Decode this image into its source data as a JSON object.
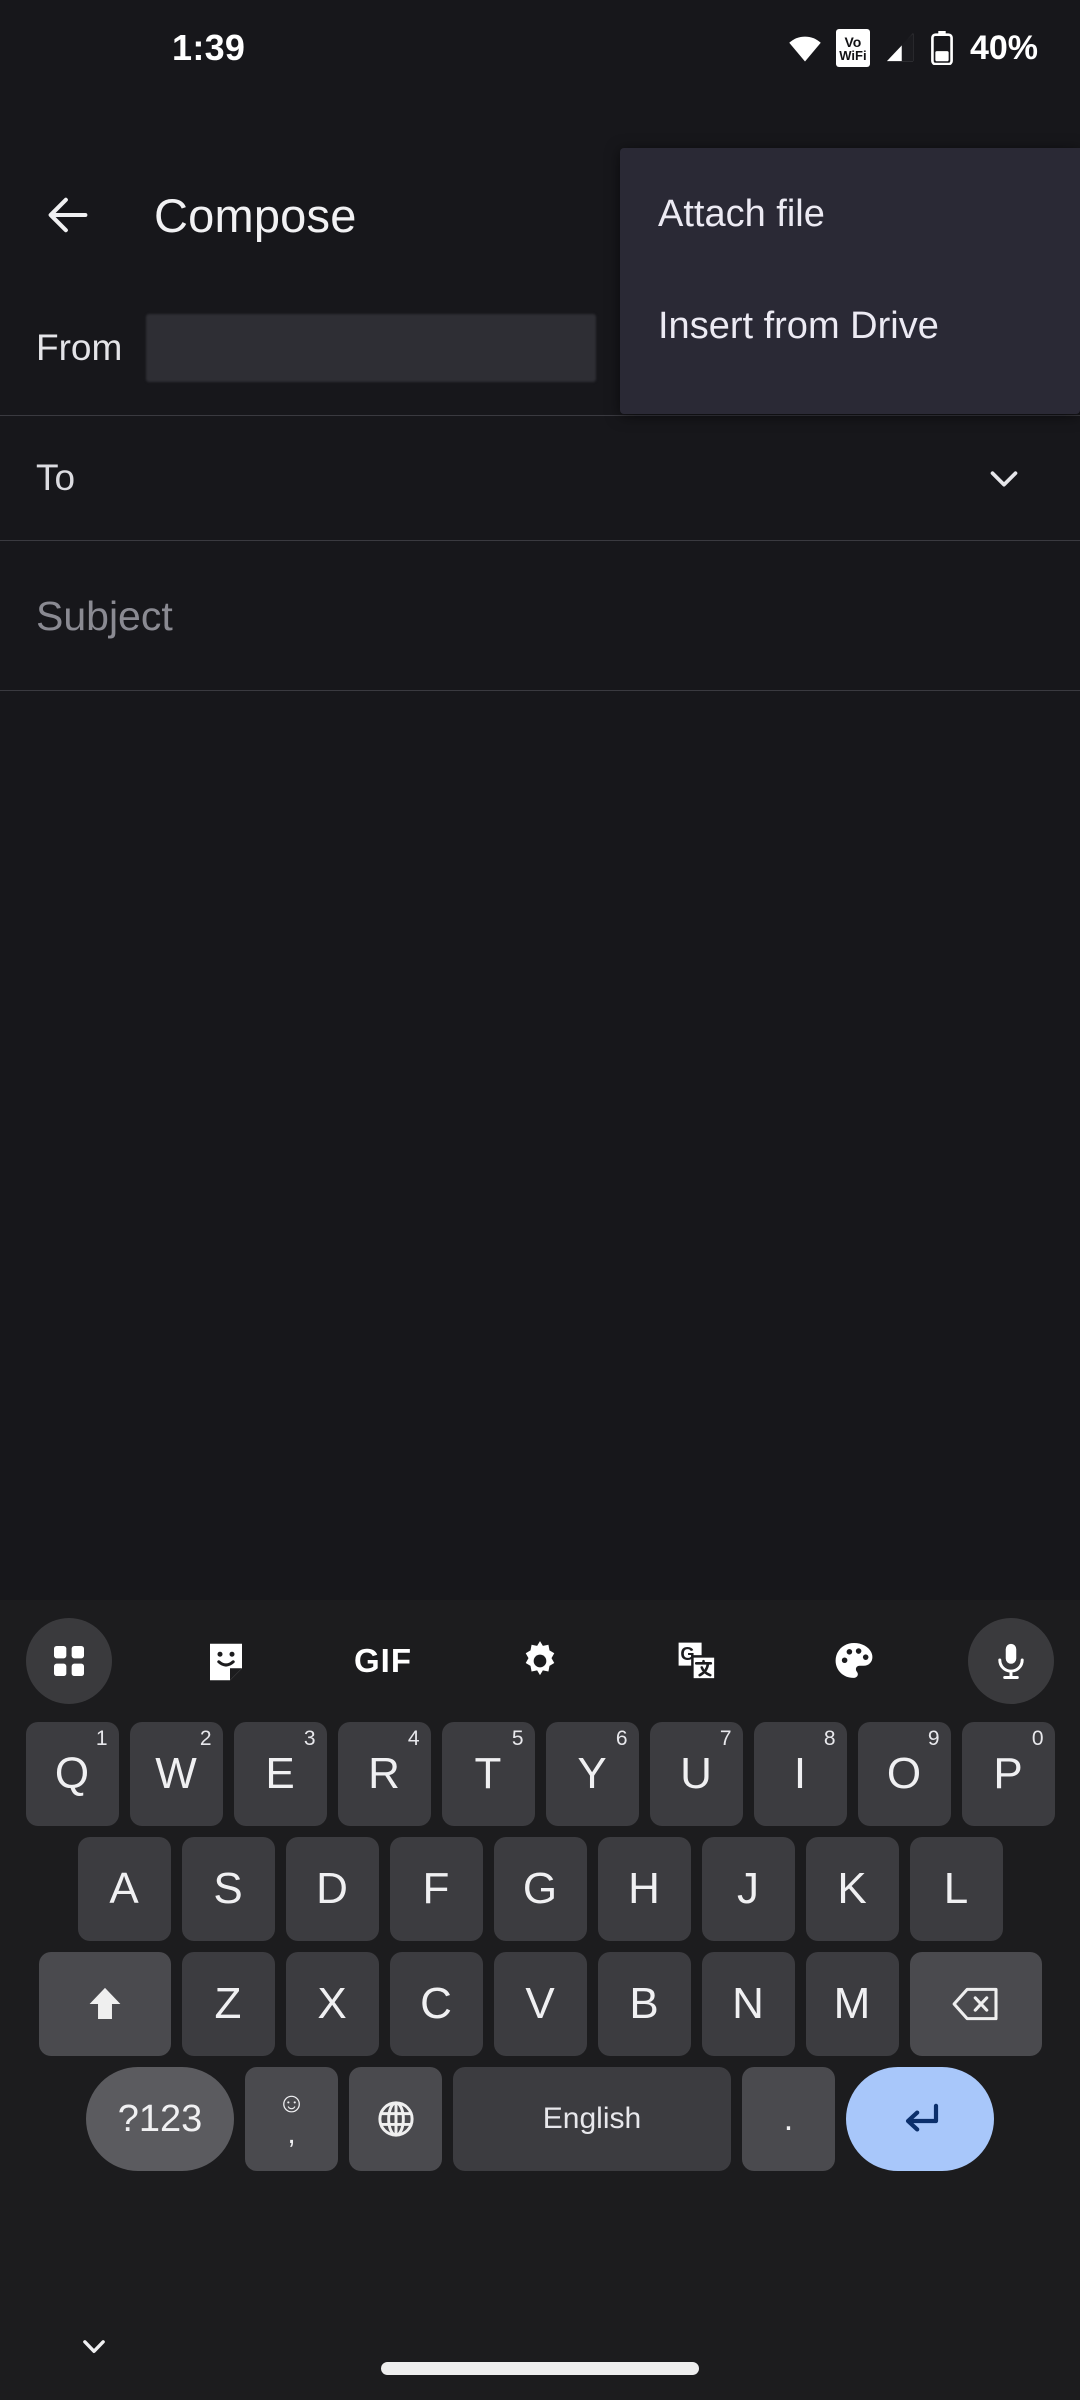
{
  "status_bar": {
    "time": "1:39",
    "battery_percent": "40%",
    "vowifi_line1": "Vo",
    "vowifi_line2": "WiFi",
    "icons": [
      "wifi-icon",
      "vowifi-icon",
      "cellular-signal-icon",
      "battery-icon"
    ]
  },
  "app_bar": {
    "title": "Compose",
    "back_icon": "arrow-back-icon"
  },
  "compose": {
    "from_label": "From",
    "from_value": "",
    "to_label": "To",
    "to_value": "",
    "to_expand_icon": "chevron-down-icon",
    "subject_placeholder": "Subject",
    "subject_value": "",
    "body_value": ""
  },
  "overflow_menu": {
    "visible": true,
    "background": "#2a2935",
    "items": [
      {
        "label": "Attach file"
      },
      {
        "label": "Insert from Drive"
      }
    ]
  },
  "keyboard": {
    "toolbar": [
      {
        "name": "apps-grid-icon",
        "pill": true
      },
      {
        "name": "sticker-icon",
        "pill": false
      },
      {
        "name": "gif-icon",
        "label": "GIF",
        "pill": false
      },
      {
        "name": "settings-gear-icon",
        "pill": false
      },
      {
        "name": "translate-icon",
        "pill": false
      },
      {
        "name": "palette-icon",
        "pill": false
      },
      {
        "name": "microphone-icon",
        "pill": true
      }
    ],
    "row1": [
      {
        "letter": "Q",
        "num": "1"
      },
      {
        "letter": "W",
        "num": "2"
      },
      {
        "letter": "E",
        "num": "3"
      },
      {
        "letter": "R",
        "num": "4"
      },
      {
        "letter": "T",
        "num": "5"
      },
      {
        "letter": "Y",
        "num": "6"
      },
      {
        "letter": "U",
        "num": "7"
      },
      {
        "letter": "I",
        "num": "8"
      },
      {
        "letter": "O",
        "num": "9"
      },
      {
        "letter": "P",
        "num": "0"
      }
    ],
    "row2": [
      "A",
      "S",
      "D",
      "F",
      "G",
      "H",
      "J",
      "K",
      "L"
    ],
    "row3": [
      "Z",
      "X",
      "C",
      "V",
      "B",
      "N",
      "M"
    ],
    "shift_icon": "shift-up-arrow-icon",
    "backspace_icon": "backspace-delete-icon",
    "row4": {
      "symbols_label": "?123",
      "comma_emoji": "☺",
      "comma_label": ",",
      "globe_icon": "globe-language-icon",
      "space_label": "English",
      "period_label": ".",
      "enter_icon": "enter-return-icon",
      "enter_color": "#a8c7fa"
    }
  },
  "nav_bar": {
    "hide_keyboard_icon": "chevron-down-icon",
    "home_indicator": "gesture-home-bar"
  }
}
